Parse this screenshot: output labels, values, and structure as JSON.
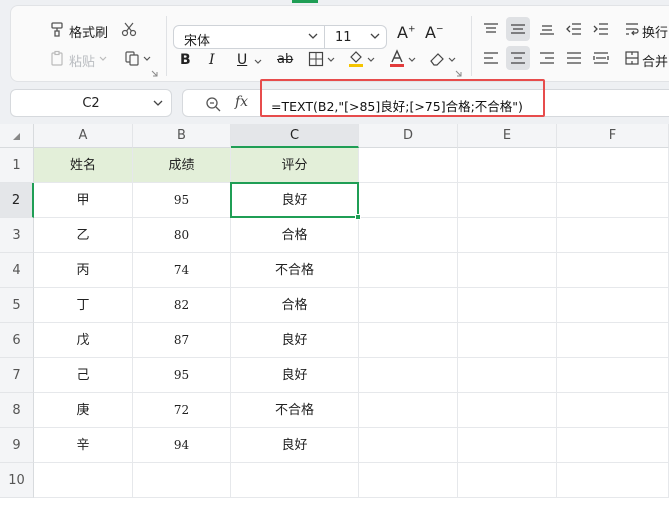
{
  "ribbon": {
    "format_painter": "格式刷",
    "paste": "粘贴",
    "font_name": "宋体",
    "font_size": "11",
    "wrap_text": "换行",
    "merge": "合并"
  },
  "formula_bar": {
    "name_box": "C2",
    "fx_label": "fx",
    "formula": "=TEXT(B2,\"[>85]良好;[>75]合格;不合格\")"
  },
  "sheet": {
    "columns": [
      "A",
      "B",
      "C",
      "D",
      "E",
      "F"
    ],
    "rows": [
      "1",
      "2",
      "3",
      "4",
      "5",
      "6",
      "7",
      "8",
      "9",
      "10"
    ],
    "headers": [
      "姓名",
      "成绩",
      "评分"
    ],
    "data": [
      [
        "甲",
        "95",
        "良好"
      ],
      [
        "乙",
        "80",
        "合格"
      ],
      [
        "丙",
        "74",
        "不合格"
      ],
      [
        "丁",
        "82",
        "合格"
      ],
      [
        "戊",
        "87",
        "良好"
      ],
      [
        "己",
        "95",
        "良好"
      ],
      [
        "庚",
        "72",
        "不合格"
      ],
      [
        "辛",
        "94",
        "良好"
      ]
    ],
    "active_cell": "C2"
  },
  "colors": {
    "accent": "#1f9e55",
    "header_fill": "#e3efd9",
    "highlight": "#e74c4c"
  }
}
